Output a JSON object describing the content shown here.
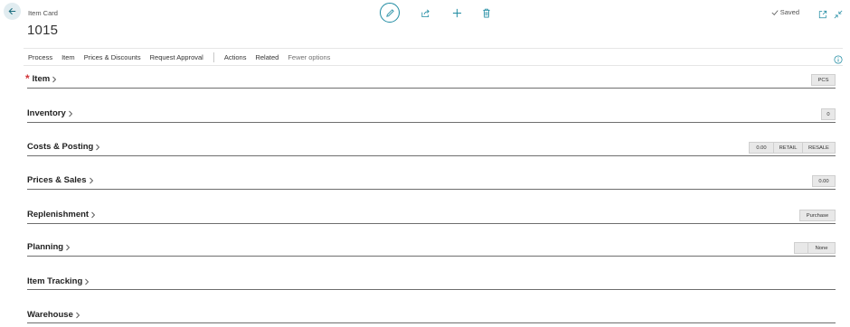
{
  "header": {
    "page_caption": "Item Card",
    "record_title": "1015",
    "saved_label": "Saved"
  },
  "action_bar": {
    "items": [
      "Process",
      "Item",
      "Prices & Discounts",
      "Request Approval"
    ],
    "items2": [
      "Actions",
      "Related"
    ],
    "fewer_options": "Fewer options"
  },
  "sections": [
    {
      "title": "Item",
      "required": true,
      "chips": [
        "PCS"
      ]
    },
    {
      "title": "Inventory",
      "required": false,
      "chips": [
        "0"
      ]
    },
    {
      "title": "Costs & Posting",
      "required": false,
      "chips": [
        "0.00",
        "RETAIL",
        "RESALE"
      ]
    },
    {
      "title": "Prices & Sales",
      "required": false,
      "chips": [
        "0.00"
      ]
    },
    {
      "title": "Replenishment",
      "required": false,
      "chips": [
        "Purchase"
      ]
    },
    {
      "title": "Planning",
      "required": false,
      "chips": [
        "",
        "None"
      ]
    },
    {
      "title": "Item Tracking",
      "required": false,
      "chips": []
    },
    {
      "title": "Warehouse",
      "required": false,
      "chips": []
    }
  ],
  "icons": {
    "back": "arrow-left-icon",
    "edit": "pencil-icon",
    "share": "share-icon",
    "add": "plus-icon",
    "delete": "trash-icon",
    "open_new": "open-in-new-window-icon",
    "collapse": "collapse-icon",
    "info": "info-icon"
  },
  "colors": {
    "accent": "#1d8aa1",
    "required": "#d13438"
  }
}
